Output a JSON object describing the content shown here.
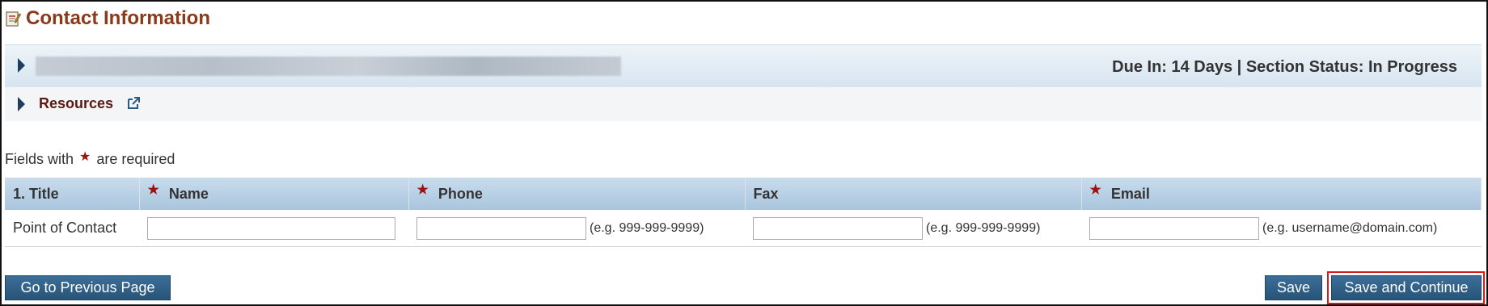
{
  "page": {
    "title": "Contact Information"
  },
  "status_bar": {
    "due_text": "Due In: 14 Days | Section Status: In Progress"
  },
  "resources": {
    "label": "Resources"
  },
  "required_note": {
    "prefix": "Fields with",
    "suffix": "are required"
  },
  "table": {
    "columns": [
      {
        "label": "1. Title",
        "required": false
      },
      {
        "label": "Name",
        "required": true
      },
      {
        "label": "Phone",
        "required": true
      },
      {
        "label": "Fax",
        "required": false
      },
      {
        "label": "Email",
        "required": true
      }
    ],
    "rows": [
      {
        "title": "Point of Contact",
        "name": "",
        "phone": "",
        "phone_hint": "(e.g. 999-999-9999)",
        "fax": "",
        "fax_hint": "(e.g. 999-999-9999)",
        "email": "",
        "email_hint": "(e.g. username@domain.com)"
      }
    ]
  },
  "buttons": {
    "previous": "Go to Previous Page",
    "save": "Save",
    "save_continue": "Save and Continue"
  },
  "colors": {
    "title": "#8a3a1a",
    "button": "#275477",
    "required_star": "#a01010",
    "highlight_border": "#d81a1a"
  },
  "icons": [
    "document-icon",
    "caret-right-icon",
    "external-link-icon",
    "required-star-icon"
  ]
}
